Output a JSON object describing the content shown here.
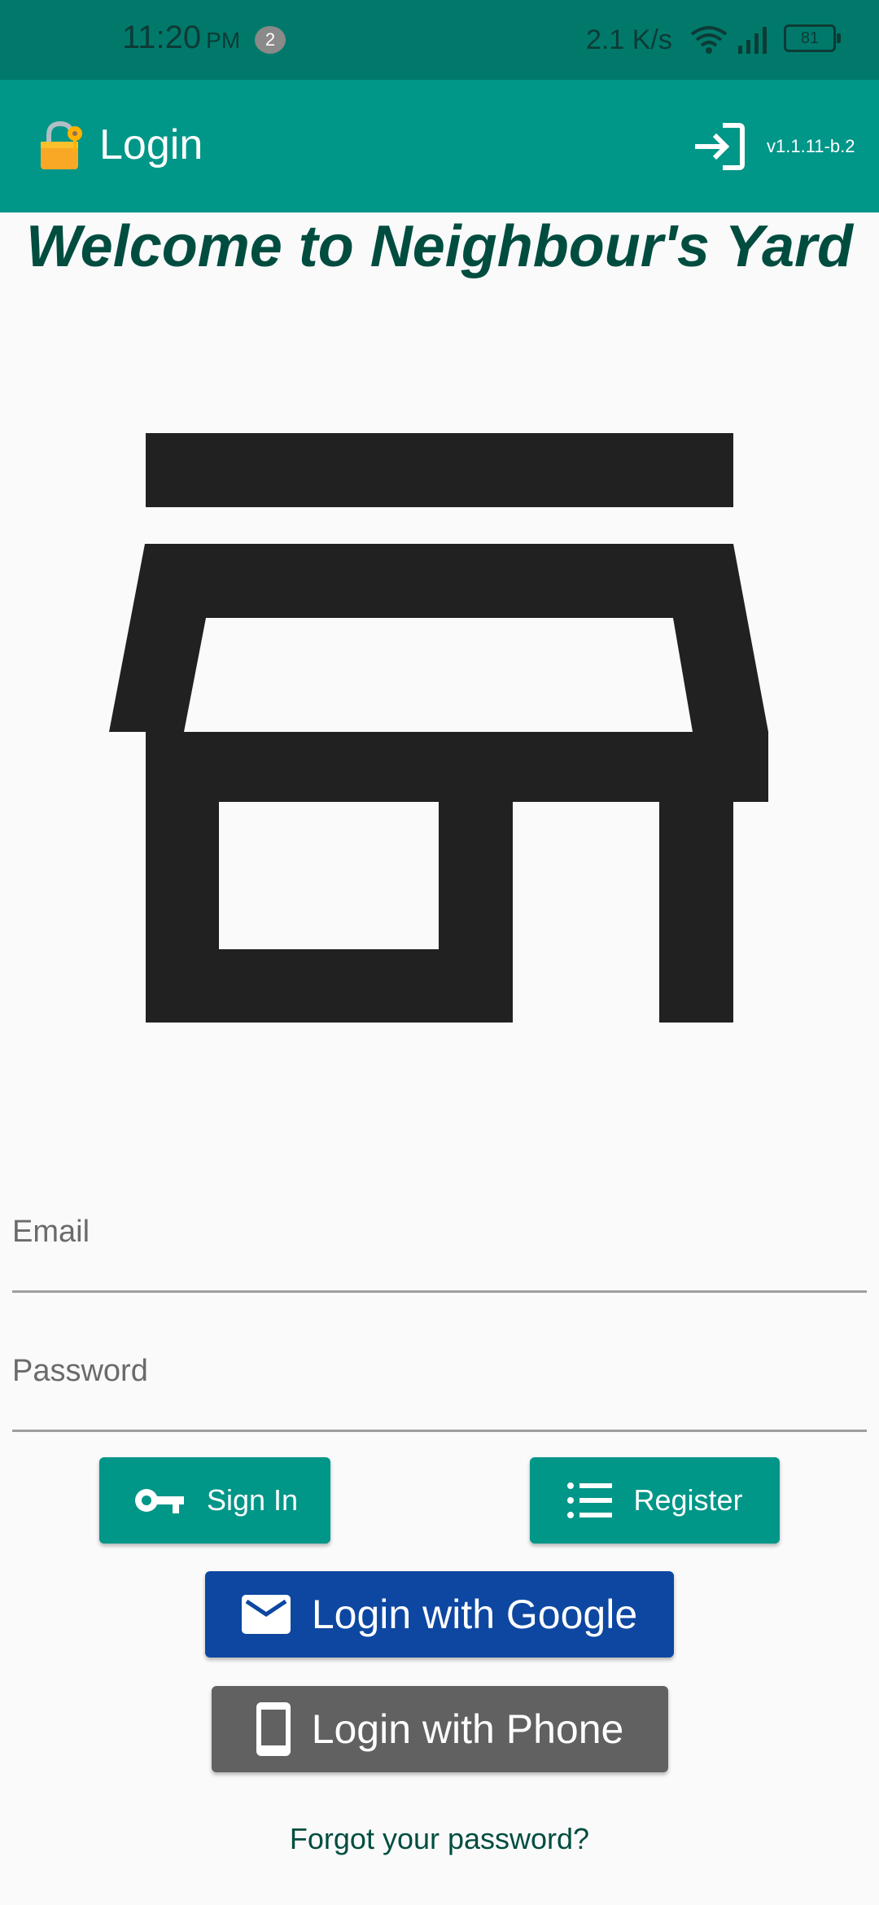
{
  "status_bar": {
    "time": "11:20",
    "ampm": "PM",
    "notification_count": "2",
    "network_speed": "2.1 K/s",
    "battery": "81",
    "icons": [
      "wifi-icon",
      "signal-icon",
      "battery-icon"
    ]
  },
  "app_bar": {
    "icon": "lock-key-icon",
    "title": "Login",
    "action_icon": "login-icon",
    "version": "v1.1.11-b.2"
  },
  "welcome_text": "Welcome to Neighbour's Yard",
  "hero_icon": "store-icon",
  "form": {
    "email_placeholder": "Email",
    "password_placeholder": "Password"
  },
  "buttons": {
    "sign_in": "Sign In",
    "register": "Register",
    "google": "Login with Google",
    "phone": "Login with Phone"
  },
  "forgot_password": "Forgot your password?",
  "colors": {
    "status_bar": "#00796b",
    "app_bar": "#009688",
    "accent_dark": "#004d40",
    "google_button": "#0d47a1",
    "phone_button": "#616161",
    "background": "#fafafa"
  }
}
